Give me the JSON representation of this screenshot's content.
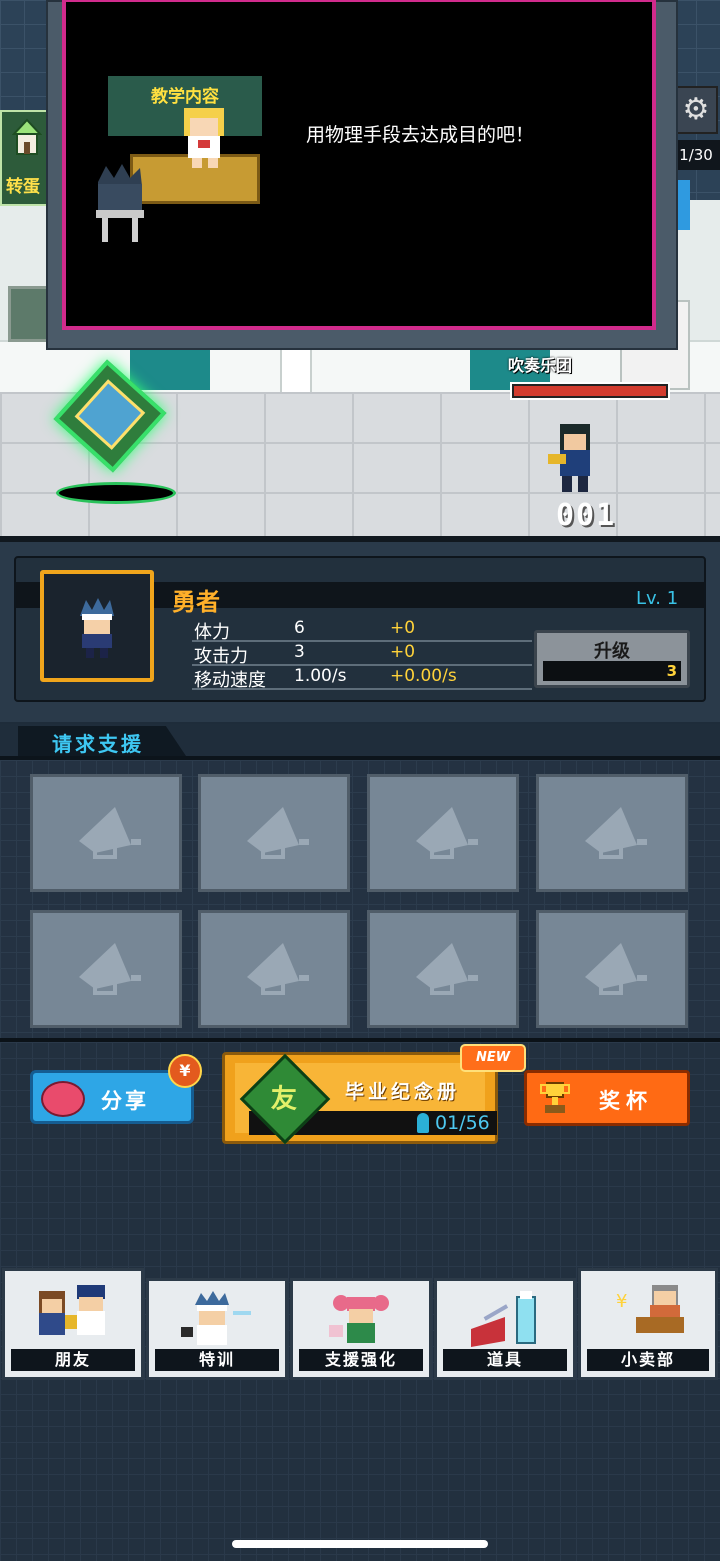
{
  "scene": {
    "side_button_label": "转蛋",
    "counter": "1/30",
    "enemy_label": "吹奏乐团",
    "enemy_hp_fraction": 1.0,
    "damage_text": "001"
  },
  "dialog": {
    "banner_title": "教学内容",
    "message": "用物理手段去达成目的吧！"
  },
  "character": {
    "name": "勇者",
    "level": "Lv. 1",
    "stats": [
      {
        "label": "体力",
        "value": "6",
        "bonus": "+0"
      },
      {
        "label": "攻击力",
        "value": "3",
        "bonus": "+0"
      },
      {
        "label": "移动速度",
        "value": "1.00/s",
        "bonus": "+0.00/s"
      }
    ],
    "upgrade_label": "升级",
    "upgrade_cost": "3"
  },
  "support": {
    "tab_label": "请求支援",
    "slot_icon": "megaphone-icon"
  },
  "actions": {
    "share_label": "分享",
    "share_badge": "¥",
    "album_title": "毕业纪念册",
    "album_book_glyph": "友",
    "album_count": "01/56",
    "album_badge": "NEW",
    "trophy_label": "奖杯"
  },
  "nav": {
    "friends": "朋友",
    "training": "特训",
    "support_boost": "支援强化",
    "items": "道具",
    "shop": "小卖部"
  },
  "colors": {
    "accent_orange": "#f0a51c",
    "accent_cyan": "#39c2e6",
    "dialog_border": "#d12b8c",
    "hp_red": "#d23b2e"
  }
}
